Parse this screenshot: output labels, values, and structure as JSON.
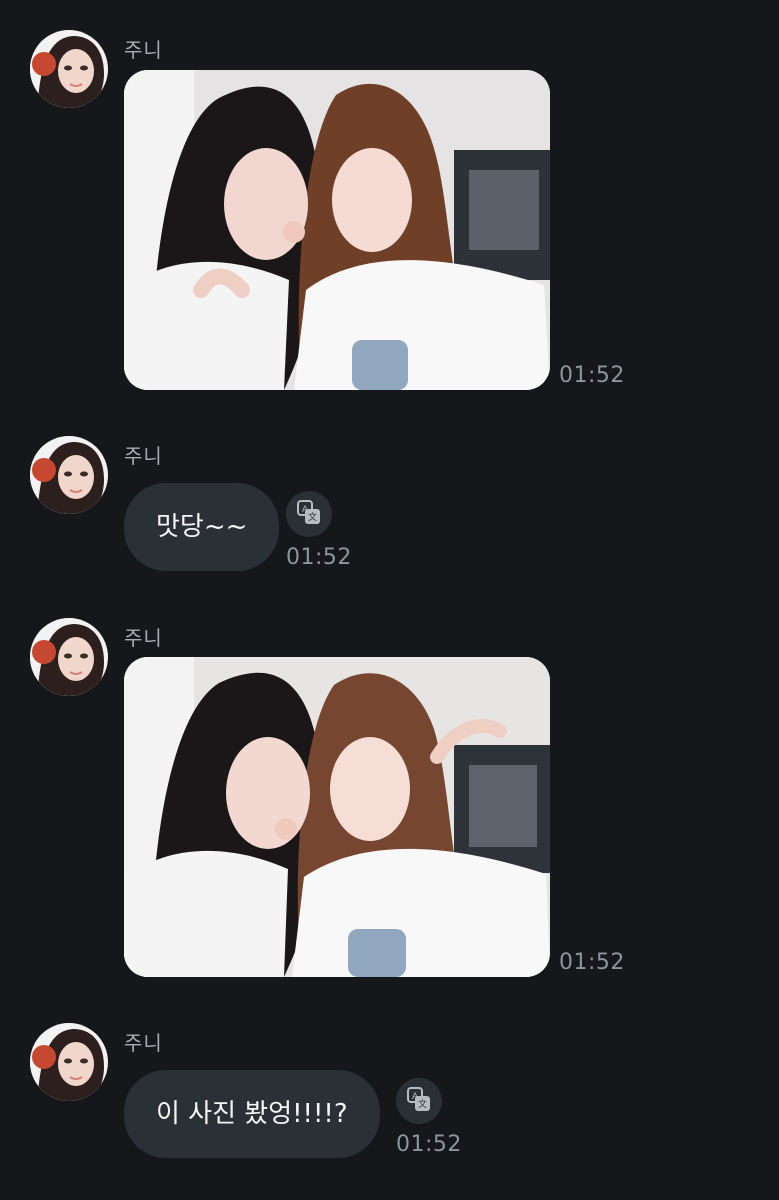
{
  "messages": [
    {
      "sender": "주니",
      "type": "image",
      "time": "01:52"
    },
    {
      "sender": "주니",
      "type": "text",
      "text": "맛당~~",
      "time": "01:52"
    },
    {
      "sender": "주니",
      "type": "image",
      "time": "01:52"
    },
    {
      "sender": "주니",
      "type": "text",
      "text": "이 사진 봤엉!!!!?",
      "time": "01:52"
    }
  ],
  "icons": {
    "translate": "translate-icon",
    "avatar": "avatar"
  },
  "colors": {
    "background": "#15171b",
    "bubble": "#2b2f36",
    "meta_text": "#8f939a"
  }
}
